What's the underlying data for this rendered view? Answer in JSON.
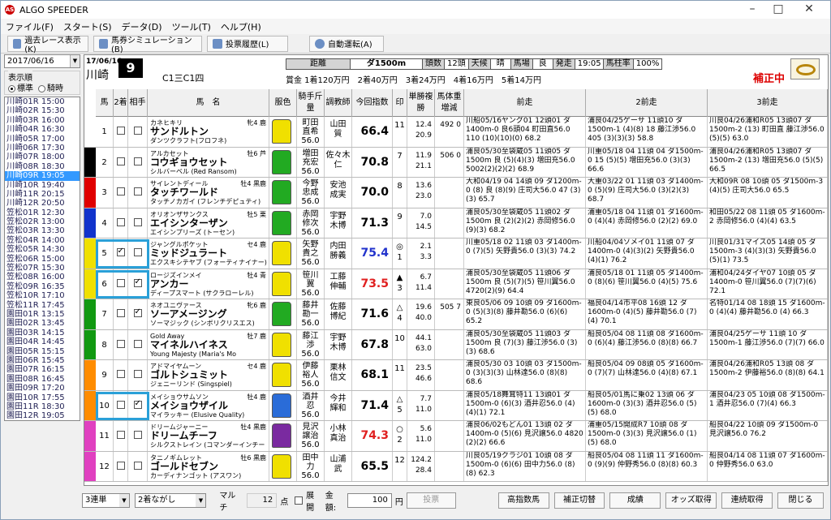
{
  "app": {
    "title": "ALGO SPEEDER",
    "icon": "AS"
  },
  "menu": [
    "ファイル(F)",
    "スタート(S)",
    "データ(D)",
    "ツール(T)",
    "ヘルプ(H)"
  ],
  "toolbar": [
    "過去レース表示(K)",
    "馬券シミュレーション(B)",
    "投票履歴(L)",
    "自動運転(A)"
  ],
  "left": {
    "date": "2017/06/16",
    "order_label": "表示順",
    "order_opts": [
      "標準",
      "騎時"
    ],
    "races": [
      "川崎01R 15:00",
      "川崎02R 15:30",
      "川崎03R 16:00",
      "川崎04R 16:30",
      "川崎05R 17:00",
      "川崎06R 17:30",
      "川崎07R 18:00",
      "川崎08R 18:30",
      "川崎09R 19:05",
      "川崎10R 19:40",
      "川崎11R 20:15",
      "川崎12R 20:50",
      "笠松01R 12:30",
      "笠松02R 13:00",
      "笠松03R 13:30",
      "笠松04R 14:00",
      "笠松05R 14:30",
      "笠松06R 15:00",
      "笠松07R 15:30",
      "笠松08R 16:00",
      "笠松09R 16:35",
      "笠松10R 17:10",
      "笠松11R 17:45",
      "園田01R 13:15",
      "園田02R 13:45",
      "園田03R 14:15",
      "園田04R 14:45",
      "園田05R 15:15",
      "園田06R 15:45",
      "園田07R 16:15",
      "園田08R 16:45",
      "園田09R 17:20",
      "園田10R 17:55",
      "園田11R 18:30",
      "園田12R 19:05"
    ],
    "selected": 8
  },
  "race": {
    "date": "17/06/16",
    "venue": "川崎",
    "num": "9",
    "class": "C1三C1四",
    "dist_lbl": "距離",
    "dist": "ダ1500m",
    "heads_lbl": "頭数",
    "heads": "12頭",
    "weather_lbl": "天候",
    "weather": "晴",
    "track_lbl": "馬場",
    "track": "良",
    "start_lbl": "発走",
    "start": "19:05",
    "rate_lbl": "馬柱率",
    "rate": "100%",
    "prize": "賞金 1着120万円　2着40万円　3着24万円　4着16万円　5着14万円",
    "hosei": "補正中"
  },
  "headers": [
    "馬",
    "2着",
    "相手",
    "馬　名",
    "服色",
    "騎手斤量",
    "調教師",
    "今回指数",
    "印",
    "単勝複勝",
    "馬体重増減",
    "前走",
    "2前走",
    "3前走"
  ],
  "horses": [
    {
      "num": "1",
      "waku": "#ffffff",
      "sire": "カネヒキリ",
      "name": "サンドルトン",
      "dam": "ダンツクラフト(フロフネ)",
      "sex": "牝4 鹿",
      "jockey": "町田 直希",
      "weight": "56.0",
      "trainer": "山田 質",
      "hi": "66.4",
      "hic": "#000",
      "mark": "",
      "pop": "11",
      "odds": "12.4 20.9",
      "bw": "492 0",
      "c2": false,
      "c3": false,
      "p1": "川船05/16ヤング01 12頭01 ダ1400m-0 良6頭04 町田直56.0 110 (10)(10)(0) 68.2",
      "p2": "浦良04/25ゲーサ 11頭10 ダ1500m-1 (4)(8) 18 藤江渉56.0 405 (3)(3)(3) 58.8",
      "p3": "川良04/26浦和R05 13頭07 ダ1500m-2 (13) 町田直 藤江渉56.0 (5)(5) 63.0",
      "silk": "#f0e000"
    },
    {
      "num": "2",
      "waku": "#000000",
      "sire": "アルカセット",
      "name": "コウギョウセット",
      "dam": "シルバーベル (Red Ransom)",
      "sex": "牡6 芦",
      "jockey": "増田 充宏",
      "weight": "56.0",
      "trainer": "佐々木仁",
      "hi": "70.8",
      "hic": "#000",
      "mark": "",
      "pop": "7",
      "odds": "11.9 21.1",
      "bw": "506 0",
      "c2": false,
      "c3": false,
      "p1": "浦良05/30至袋蔵05 11頭05 ダ1500m 良 (5)(4)(3) 増田充56.0 5002(2)(2)(2) 68.9",
      "p2": "川重05/18 04 11頭 04 ダ1500m-0 15 (5)(5) 増田充56.0 (3)(3) 66.6",
      "p3": "浦良04/26浦和R05 13頭07 ダ1500m-2 (13) 増田充56.0 (5)(5) 66.5",
      "silk": "#22aa22"
    },
    {
      "num": "3",
      "waku": "#e00000",
      "sire": "サイレントディール",
      "name": "タッチワールド",
      "dam": "タッチノカガイ (フレンチデピュティ)",
      "sex": "牡4 黒鹿",
      "jockey": "今野 忠成",
      "weight": "56.0",
      "trainer": "安池 成実",
      "hi": "70.0",
      "hic": "#000",
      "mark": "",
      "pop": "8",
      "odds": "13.6 23.0",
      "bw": "",
      "c2": false,
      "c3": false,
      "p1": "大和04/19 04 14頭 09 ダ1200m-0 (8) 良 (8)(9) 庄司大56.0 47 (3)(3) 65.7",
      "p2": "大重03/22 01 11頭 03 ダ1400m-0 (5)(9) 庄司大56.0 (3)(2)(3) 68.7",
      "p3": "大和09R 08 10頭 05 ダ1500m-3 (4)(5) 庄司大56.0 65.5",
      "silk": "#22aa22"
    },
    {
      "num": "4",
      "waku": "#1133cc",
      "sire": "オリオンザサンクス",
      "name": "エイシンターザン",
      "dam": "エイシンプリーズ (トーセン)",
      "sex": "牡5 栗",
      "jockey": "赤岡 修次",
      "weight": "56.0",
      "trainer": "宇野 木博",
      "hi": "71.3",
      "hic": "#000",
      "mark": "",
      "pop": "9",
      "odds": "7.0 14.5",
      "bw": "",
      "c2": false,
      "c3": false,
      "p1": "浦良05/30至袋蔵05 11頭02 ダ1500m 良 (2)(2)(2) 赤岡修56.0 (9)(3) 68.2",
      "p2": "浦重05/18 04 11頭 01 ダ1600m-0 (4)(4) 赤岡修56.0 (2)(2) 69.0",
      "p3": "和田05/22 08 11頭 05 ダ1600m-2 赤岡修56.0 (4)(4) 63.5",
      "silk": "#22aa22"
    },
    {
      "num": "5",
      "waku": "#f0e000",
      "sire": "ジャングルポケット",
      "name": "ミッドジュラート",
      "dam": "エクスキシテヤブ (フォーティナイナー)",
      "sex": "セ4 鹿",
      "jockey": "矢野 貴之",
      "weight": "56.0",
      "trainer": "内田 勝義",
      "hi": "75.4",
      "hic": "#2233cc",
      "mark": "◎",
      "pop": "1",
      "odds": "2.1 3.3",
      "bw": "",
      "c2": true,
      "c3": false,
      "p1": "川重05/18 02 11頭 03 ダ1400m-0 (7)(5) 矢野貴56.0 (3)(3) 74.2",
      "p2": "川船04/04ソメイ01 11頭 07 ダ1400m-0 (4)(3)(2) 矢野貴56.0 (4)(1) 76.2",
      "p3": "川良01/31マイス05 14頭 05 ダ1500m-3 (4)(3)(3) 矢野貴56.0 (5)(1) 73.5",
      "silk": "#f0e000"
    },
    {
      "num": "6",
      "waku": "#f0e000",
      "sire": "ロージズインメイ",
      "name": "アンカー",
      "dam": "ディープスマート (サクラローレル)",
      "sex": "牡4 青",
      "jockey": "笹川 翼",
      "weight": "56.0",
      "trainer": "工藤 伸輔",
      "hi": "73.5",
      "hic": "#e02020",
      "mark": "▲",
      "pop": "3",
      "odds": "6.7 11.4",
      "bw": "",
      "c2": false,
      "c3": true,
      "p1": "浦良05/30至袋蔵05 11頭06 ダ1500m 良 (5)(7)(5) 笹川翼56.0 4720(2)(9) 64.4",
      "p2": "浦良05/18 01 11頭 05 ダ1400m-0 (8)(6) 笹川翼56.0 (4)(5) 75.6",
      "p3": "浦和04/24ダイヤ07 10頭 05 ダ1400m-0 笹川翼56.0 (7)(7)(6) 72.1",
      "silk": "#f0e000"
    },
    {
      "num": "7",
      "waku": "#119911",
      "sire": "ネオユニヴァース",
      "name": "ソーアメージング",
      "dam": "ソーマジック (シンボリクリスエス)",
      "sex": "牝6 鹿",
      "jockey": "藤井 勘一",
      "weight": "56.0",
      "trainer": "佐藤 博紀",
      "hi": "71.6",
      "hic": "#000",
      "mark": "△",
      "pop": "4",
      "odds": "19.6 40.0",
      "bw": "505 7",
      "c2": false,
      "c3": true,
      "p1": "東良05/06 09 10頭 09 ダ1600m-0 (5)(3)(8) 藤井勘56.0 (6)(6) 65.2",
      "p2": "福良04/14市平08 16頭 12 ダ1600m-0 (4)(5) 藤井勘56.0 (7)(4) 70.1",
      "p3": "名特01/14 08 18頭 15 ダ1600m-0 (4)(4) 藤井勘56.0 (4) 66.3",
      "silk": "#22aa22"
    },
    {
      "num": "8",
      "waku": "#119911",
      "sire": "Gold Away",
      "name": "マイネルハイネス",
      "dam": "Young Majesty (Maria's Mo",
      "sex": "牡7 鹿",
      "jockey": "藤江 渉",
      "weight": "56.0",
      "trainer": "宇野 木博",
      "hi": "67.8",
      "hic": "#000",
      "mark": "",
      "pop": "10",
      "odds": "44.1 63.0",
      "bw": "",
      "c2": false,
      "c3": false,
      "p1": "浦良05/30至袋蔵05 11頭03 ダ1500m 良 (7)(3) 藤江渉56.0 (3)(3) 68.6",
      "p2": "船良05/04 08 11頭 08 ダ1600m-0 (6)(4) 藤江渉56.0 (8)(8) 66.7",
      "p3": "浦良04/25ゲーサ 11頭 10 ダ1500m-1 藤江渉56.0 (7)(7) 66.0",
      "silk": "#f0e000"
    },
    {
      "num": "9",
      "waku": "#ff8c00",
      "sire": "アドマイヤムーン",
      "name": "ゴルトシュミット",
      "dam": "ジェニーリンド (Singspiel)",
      "sex": "セ4 鹿",
      "jockey": "伊藤 裕人",
      "weight": "56.0",
      "trainer": "栗林 信文",
      "hi": "68.1",
      "hic": "#000",
      "mark": "",
      "pop": "11",
      "odds": "23.5 46.6",
      "bw": "",
      "c2": false,
      "c3": false,
      "p1": "浦良05/30 03 10頭 03 ダ1500m-0 (3)(3)(3) 山林達56.0 (8)(8) 68.6",
      "p2": "船良05/04 09 08頭 05 ダ1600m-0 (7)(7) 山林達56.0 (4)(8) 67.1",
      "p3": "浦良04/26浦和R05 13頭 08 ダ1500m-2 伊藤裕56.0 (8)(8) 64.1",
      "silk": "#f0e000"
    },
    {
      "num": "10",
      "waku": "#ff8c00",
      "sire": "メイショウサムソン",
      "name": "メイショウザイル",
      "dam": "マイラッキー (Elusive Quality)",
      "sex": "牡4 鹿",
      "jockey": "酒井 忍",
      "weight": "56.0",
      "trainer": "今井 輝和",
      "hi": "71.4",
      "hic": "#000",
      "mark": "△",
      "pop": "5",
      "odds": "7.7 11.0",
      "bw": "",
      "c2": false,
      "c3": true,
      "p1": "浦良05/18舞茸特11 13頭01 ダ1500m-0 (6)(3) 酒井忍56.0 (4)(4)(1) 72.1",
      "p2": "船良05/01馬に乗02 13頭 06 ダ1600m-0 (3)(3) 酒井忍56.0 (5)(5) 68.0",
      "p3": "浦良04/23 05 10頭 08 ダ1500m-1 酒井忍56.0 (7)(4) 66.3",
      "silk": "#2a6cd8"
    },
    {
      "num": "11",
      "waku": "#e040c0",
      "sire": "ドリームジャーニー",
      "name": "ドリームチーフ",
      "dam": "シルクストレイン (コマンダーインチーフ)",
      "sex": "牡4 黒鹿",
      "jockey": "見沢 譲治",
      "weight": "56.0",
      "trainer": "小林 真治",
      "hi": "74.3",
      "hic": "#e02020",
      "mark": "○",
      "pop": "2",
      "odds": "5.6 11.0",
      "bw": "",
      "c2": false,
      "c3": false,
      "p1": "浦良06/02もどん01 13頭 02 ダ1400m-0 (5)(6) 見沢譲56.0 4820 (2)(2) 66.6",
      "p2": "浦重05/15開成R7 10頭 08 ダ1500m-0 (3)(3) 見沢譲56.0 (1)(5) 68.0",
      "p3": "船良04/22 10頭 09 ダ1500m-0 見沢譲56.0 76.2",
      "silk": "#7a2aa0"
    },
    {
      "num": "12",
      "waku": "#e040c0",
      "sire": "タニノギムレット",
      "name": "ゴールドセブン",
      "dam": "カーディナンゴット (アスワン)",
      "sex": "牡6 黒鹿",
      "jockey": "田中 力",
      "weight": "56.0",
      "trainer": "山浦 武",
      "hi": "65.5",
      "hic": "#000",
      "mark": "",
      "pop": "12",
      "odds": "124.2 28.4",
      "bw": "",
      "c2": false,
      "c3": false,
      "p1": "川良05/19クラジ01 10頭 08 ダ1500m-0 (6)(6) 田中力56.0 (8)(8) 62.3",
      "p2": "船良05/04 08 11頭 11 ダ1600m-0 (9)(9) 仲野秀56.0 (8)(8) 60.3",
      "p3": "船良04/14 08 11頭 07 ダ1600m-0 仲野秀56.0 63.0",
      "silk": "#f0e000"
    }
  ],
  "bottom": {
    "bet_type": "3連単",
    "method": "2着ながし",
    "multi_lbl": "マルチ",
    "points": "12",
    "points_unit": "点",
    "expand": "展開",
    "amount_lbl": "金額:",
    "amount": "100",
    "yen": "円",
    "vote": "投票",
    "btns": [
      "高指数馬",
      "補正切替",
      "成績",
      "オッズ取得",
      "連続取得",
      "閉じる"
    ]
  }
}
